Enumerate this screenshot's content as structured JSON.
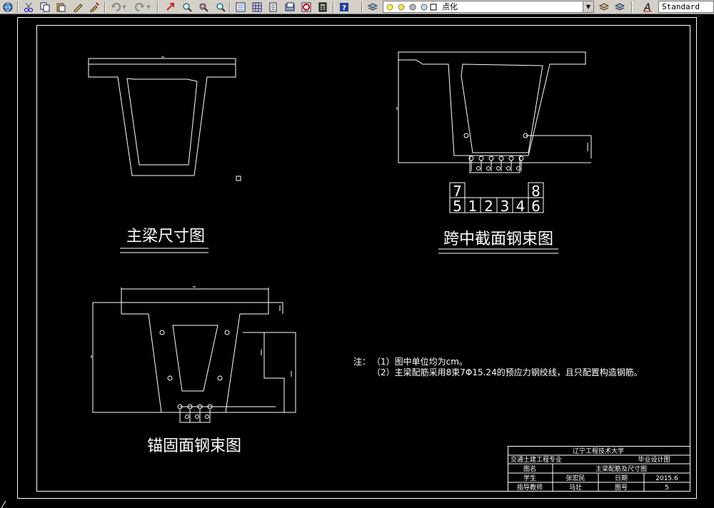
{
  "toolbar": {
    "layer_current": "点化",
    "text_style": "Standard"
  },
  "drawing": {
    "main_section_title": "主梁尺寸图",
    "midspan_title": "跨中截面钢束图",
    "anchor_title": "锚固面钢束图",
    "notes_label": "注：",
    "note1": "（1）图中单位均为cm。",
    "note2": "（2）主梁配筋采用8束7Φ15.24的预应力钢绞线，且只配置构造钢筋。",
    "tendon_grid": {
      "top_left": "7",
      "top_right": "8",
      "bottom": [
        "5",
        "1",
        "2",
        "3",
        "4",
        "6"
      ]
    },
    "small_dim_text": "\"",
    "title_block": {
      "university": "辽宁工程技术大学",
      "major": "交通土建工程专业",
      "design_type": "毕业设计图",
      "name_label": "图名",
      "drawing_name": "主梁配筋及尺寸图",
      "student_label": "学生",
      "student_name": "张宏民",
      "date_label": "日期",
      "date_value": "2015.6",
      "advisor_label": "指导教师",
      "advisor_name": "马壮",
      "number_label": "图号",
      "number_value": "5"
    }
  }
}
